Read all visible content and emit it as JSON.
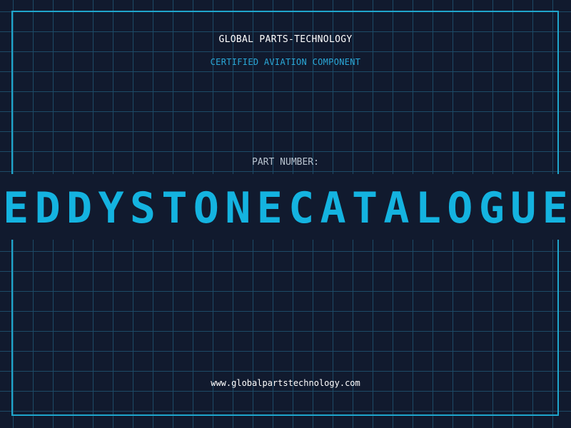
{
  "header": {
    "company": "GLOBAL PARTS-TECHNOLOGY",
    "tagline": "CERTIFIED AVIATION COMPONENT"
  },
  "part": {
    "label": "PART NUMBER:",
    "number": "EDDYSTONECATALOGUE"
  },
  "footer": {
    "website": "www.globalpartstechnology.com"
  },
  "colors": {
    "background": "#111a2e",
    "grid": "#1d4a66",
    "accent": "#14b3e0",
    "frame": "#1fa6cc"
  }
}
